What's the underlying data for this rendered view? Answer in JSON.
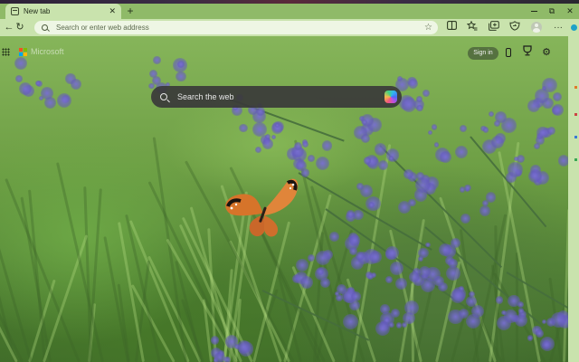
{
  "browser": {
    "tab": {
      "title": "New tab",
      "close_glyph": "✕"
    },
    "new_tab_glyph": "+",
    "window_controls": {
      "restore_glyph": "⧉",
      "close_glyph": "✕"
    },
    "nav": {
      "back_glyph": "←",
      "refresh_glyph": "↻"
    },
    "address_bar": {
      "placeholder": "Search or enter web address",
      "favorite_glyph": "☆"
    },
    "toolbar_icons": [
      "split-screen-icon",
      "favorites-icon",
      "collections-icon",
      "browser-essentials-icon",
      "more-icon"
    ],
    "more_glyph": "···"
  },
  "newtab": {
    "brand": "Microsoft",
    "brand_colors": [
      "#f25022",
      "#7fba00",
      "#00a4ef",
      "#ffb900"
    ],
    "sign_in_label": "Sign in",
    "search_placeholder": "Search the web",
    "settings_glyph": "⚙",
    "rewards_glyph": "🏆"
  },
  "colors": {
    "chrome": "#c9e3ad",
    "titlebar": "#8fba68",
    "search_bar": "#3a3a3a",
    "flowers": "#7a6fd6"
  }
}
